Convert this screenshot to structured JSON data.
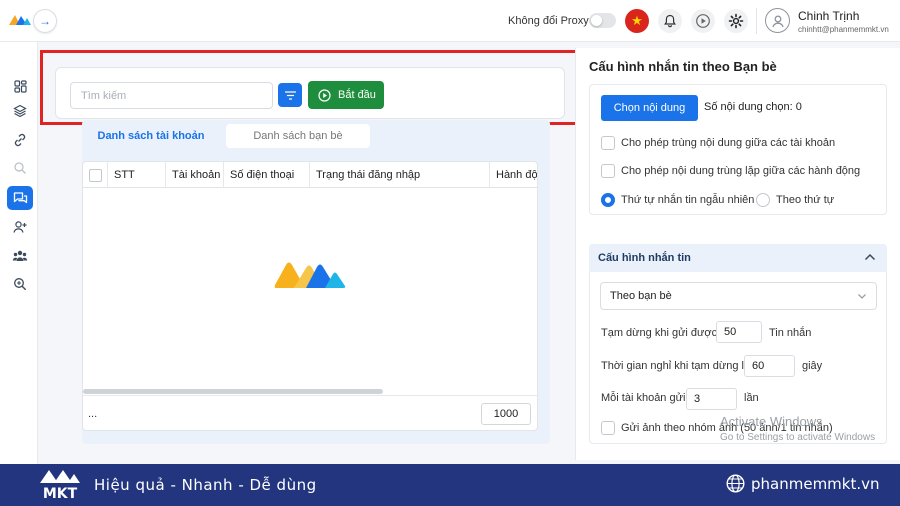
{
  "topbar": {
    "proxy_label": "Không đổi Proxy",
    "proxy_enabled": false,
    "user_name": "Chinh Trịnh",
    "user_email": "chinhtt@phanmemmkt.vn"
  },
  "colors": {
    "primary": "#1a73e8",
    "start_button": "#1e8e3e",
    "highlight_box": "#e02424",
    "banner": "#22357e"
  },
  "sidebar": {
    "items": [
      {
        "icon": "dashboard-icon",
        "active": false
      },
      {
        "icon": "layers-icon",
        "active": false
      },
      {
        "icon": "link-icon",
        "active": false
      },
      {
        "icon": "search-user-icon",
        "active": false
      },
      {
        "icon": "chat-icon",
        "active": true
      },
      {
        "icon": "add-friend-icon",
        "active": false
      },
      {
        "icon": "group-icon",
        "active": false
      },
      {
        "icon": "scan-icon",
        "active": false
      }
    ]
  },
  "search": {
    "placeholder": "Tìm kiếm",
    "start_label": "Bắt đầu"
  },
  "tabs": {
    "accounts": "Danh sách tài khoản",
    "friends": "Danh sách bạn bè"
  },
  "table": {
    "columns": [
      "STT",
      "Tài khoản",
      "Số điện thoại",
      "Trạng thái đăng nhập",
      "Hành động"
    ],
    "rows": [],
    "footer_ellipsis": "...",
    "page_size": "1000"
  },
  "config": {
    "title": "Cấu hình nhắn tin theo Bạn bè",
    "choose_button": "Chọn nội dung",
    "selected_count": "Số nội dung chọn: 0",
    "allow_duplicate_accounts": "Cho phép trùng nội dung giữa các tài khoản",
    "allow_duplicate_actions": "Cho phép nội dung trùng lặp giữa các hành động",
    "order_random": "Thứ tự nhắn tin ngẫu nhiên",
    "order_sequential": "Theo thứ tự"
  },
  "messaging": {
    "section_title": "Cấu hình nhắn tin",
    "mode_value": "Theo bạn bè",
    "pause_label": "Tạm dừng khi gửi được",
    "pause_value": "50",
    "pause_unit": "Tin nhắn",
    "rest_label": "Thời gian nghỉ khi tạm dừng là",
    "rest_value": "60",
    "rest_unit": "giây",
    "per_account_label": "Mỗi tài khoản gửi",
    "per_account_value": "3",
    "per_account_unit": "lần",
    "group_image_label": "Gửi ảnh theo nhóm ảnh (50 ảnh/1 tin nhắn)"
  },
  "watermark": {
    "line1": "Activate Windows",
    "line2": "Go to Settings to activate Windows"
  },
  "banner": {
    "brand": "MKT",
    "slogan": "Hiệu quả - Nhanh - Dễ dùng",
    "website": "phanmemmkt.vn"
  }
}
